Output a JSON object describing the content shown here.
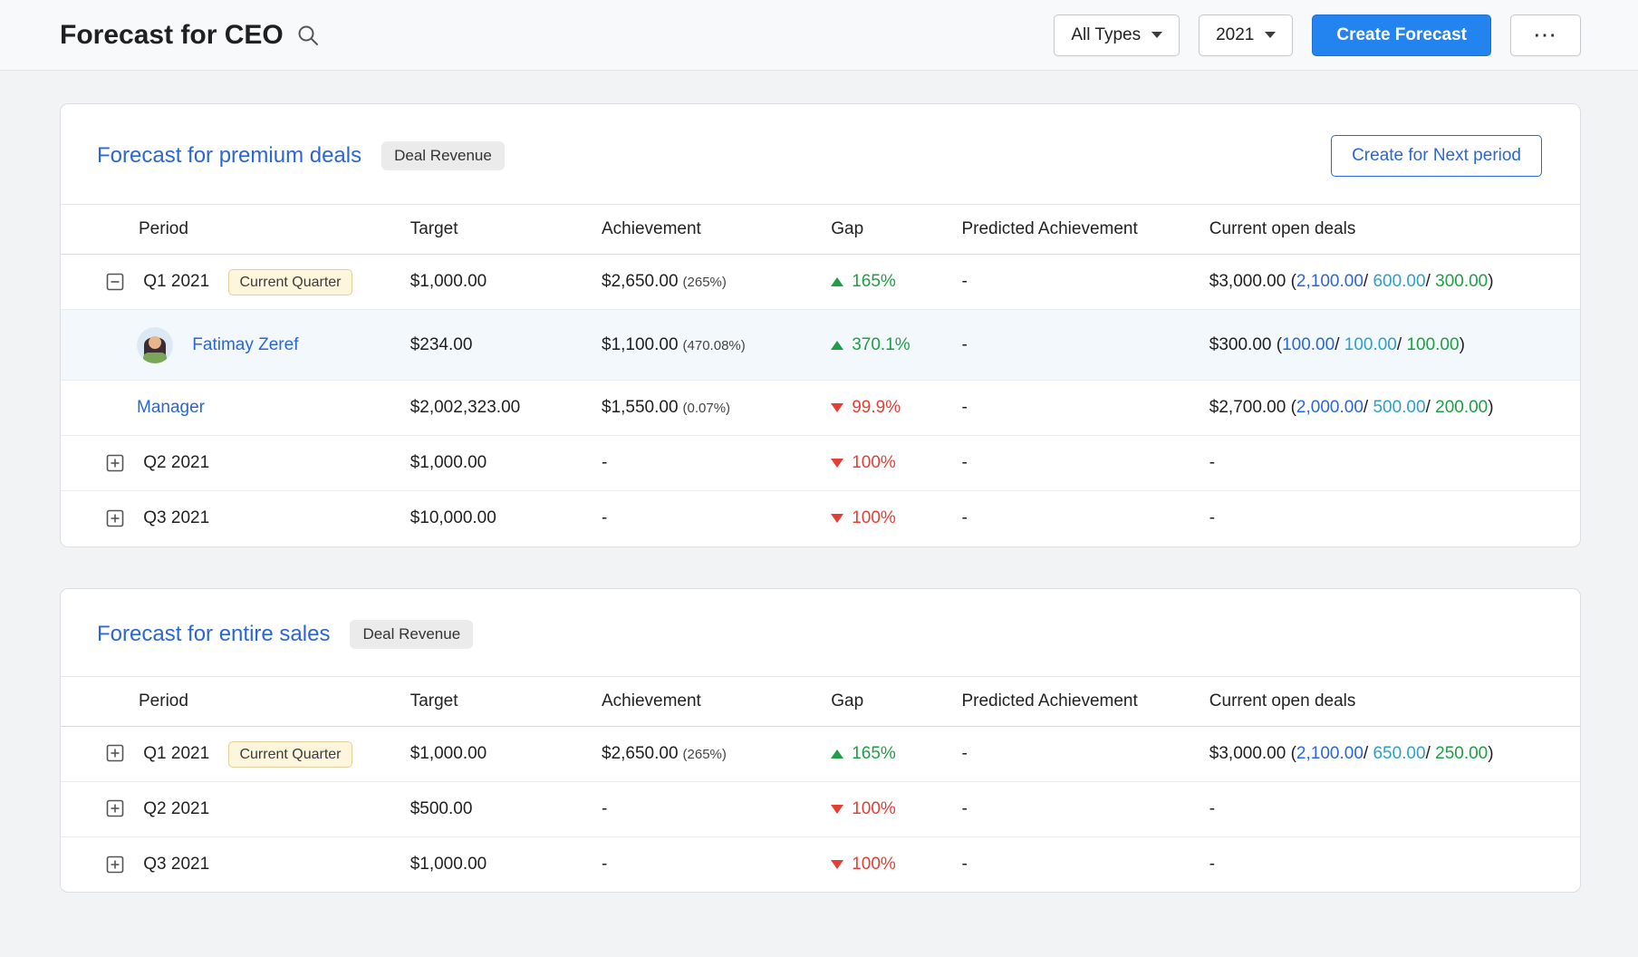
{
  "header": {
    "title": "Forecast for CEO",
    "type_filter": "All Types",
    "year_filter": "2021",
    "create_button": "Create Forecast",
    "more_button": "⋯"
  },
  "fmt": {
    "sep": "/ ",
    "close": ")"
  },
  "columns": [
    "Period",
    "Target",
    "Achievement",
    "Gap",
    "Predicted Achievement",
    "Current open deals"
  ],
  "colors": {
    "accent": "#2384f0",
    "link_blue": "#2a66d9",
    "green": "#1f9e45",
    "red": "#e43f35",
    "teal": "#2e9fc7",
    "quarter_badge_bg": "#fdf5dc"
  },
  "cards": [
    {
      "title": "Forecast for premium deals",
      "badge": "Deal Revenue",
      "action": "Create for Next period",
      "rows": [
        {
          "period": "Q1 2021",
          "quarter_badge": "Current Quarter",
          "target": "$1,000.00",
          "ach": "$2,650.00",
          "ach_pct": "(265%)",
          "gap": "165%",
          "gap_dir": "up",
          "predicted": "-",
          "open_total": "$3,000.00 (",
          "open_a": "2,100.00",
          "open_b": "600.00",
          "open_c": "300.00"
        },
        {
          "name": "Fatimay Zeref",
          "target": "$234.00",
          "ach": "$1,100.00",
          "ach_pct": "(470.08%)",
          "gap": "370.1%",
          "gap_dir": "up",
          "predicted": "-",
          "open_total": "$300.00 (",
          "open_a": "100.00",
          "open_b": "100.00",
          "open_c": "100.00"
        },
        {
          "name": "Manager",
          "target": "$2,002,323.00",
          "ach": "$1,550.00",
          "ach_pct": "(0.07%)",
          "gap": "99.9%",
          "gap_dir": "down",
          "predicted": "-",
          "open_total": "$2,700.00 (",
          "open_a": "2,000.00",
          "open_b": "500.00",
          "open_c": "200.00"
        },
        {
          "period": "Q2 2021",
          "target": "$1,000.00",
          "ach": "-",
          "gap": "100%",
          "gap_dir": "down",
          "predicted": "-",
          "open": "-"
        },
        {
          "period": "Q3 2021",
          "target": "$10,000.00",
          "ach": "-",
          "gap": "100%",
          "gap_dir": "down",
          "predicted": "-",
          "open": "-"
        }
      ]
    },
    {
      "title": "Forecast for entire sales",
      "badge": "Deal Revenue",
      "rows": [
        {
          "period": "Q1 2021",
          "quarter_badge": "Current Quarter",
          "target": "$1,000.00",
          "ach": "$2,650.00",
          "ach_pct": "(265%)",
          "gap": "165%",
          "gap_dir": "up",
          "predicted": "-",
          "open_total": "$3,000.00 (",
          "open_a": "2,100.00",
          "open_b": "650.00",
          "open_c": "250.00"
        },
        {
          "period": "Q2 2021",
          "target": "$500.00",
          "ach": "-",
          "gap": "100%",
          "gap_dir": "down",
          "predicted": "-",
          "open": "-"
        },
        {
          "period": "Q3 2021",
          "target": "$1,000.00",
          "ach": "-",
          "gap": "100%",
          "gap_dir": "down",
          "predicted": "-",
          "open": "-"
        }
      ]
    }
  ]
}
